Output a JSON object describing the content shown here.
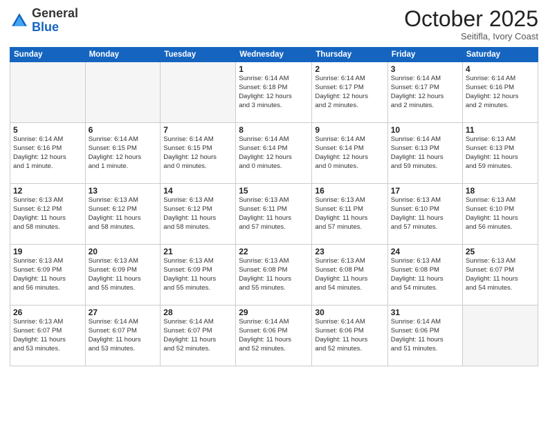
{
  "header": {
    "logo_general": "General",
    "logo_blue": "Blue",
    "month": "October 2025",
    "location": "Seitifla, Ivory Coast"
  },
  "days_of_week": [
    "Sunday",
    "Monday",
    "Tuesday",
    "Wednesday",
    "Thursday",
    "Friday",
    "Saturday"
  ],
  "weeks": [
    [
      {
        "day": "",
        "info": ""
      },
      {
        "day": "",
        "info": ""
      },
      {
        "day": "",
        "info": ""
      },
      {
        "day": "1",
        "info": "Sunrise: 6:14 AM\nSunset: 6:18 PM\nDaylight: 12 hours\nand 3 minutes."
      },
      {
        "day": "2",
        "info": "Sunrise: 6:14 AM\nSunset: 6:17 PM\nDaylight: 12 hours\nand 2 minutes."
      },
      {
        "day": "3",
        "info": "Sunrise: 6:14 AM\nSunset: 6:17 PM\nDaylight: 12 hours\nand 2 minutes."
      },
      {
        "day": "4",
        "info": "Sunrise: 6:14 AM\nSunset: 6:16 PM\nDaylight: 12 hours\nand 2 minutes."
      }
    ],
    [
      {
        "day": "5",
        "info": "Sunrise: 6:14 AM\nSunset: 6:16 PM\nDaylight: 12 hours\nand 1 minute."
      },
      {
        "day": "6",
        "info": "Sunrise: 6:14 AM\nSunset: 6:15 PM\nDaylight: 12 hours\nand 1 minute."
      },
      {
        "day": "7",
        "info": "Sunrise: 6:14 AM\nSunset: 6:15 PM\nDaylight: 12 hours\nand 0 minutes."
      },
      {
        "day": "8",
        "info": "Sunrise: 6:14 AM\nSunset: 6:14 PM\nDaylight: 12 hours\nand 0 minutes."
      },
      {
        "day": "9",
        "info": "Sunrise: 6:14 AM\nSunset: 6:14 PM\nDaylight: 12 hours\nand 0 minutes."
      },
      {
        "day": "10",
        "info": "Sunrise: 6:14 AM\nSunset: 6:13 PM\nDaylight: 11 hours\nand 59 minutes."
      },
      {
        "day": "11",
        "info": "Sunrise: 6:13 AM\nSunset: 6:13 PM\nDaylight: 11 hours\nand 59 minutes."
      }
    ],
    [
      {
        "day": "12",
        "info": "Sunrise: 6:13 AM\nSunset: 6:12 PM\nDaylight: 11 hours\nand 58 minutes."
      },
      {
        "day": "13",
        "info": "Sunrise: 6:13 AM\nSunset: 6:12 PM\nDaylight: 11 hours\nand 58 minutes."
      },
      {
        "day": "14",
        "info": "Sunrise: 6:13 AM\nSunset: 6:12 PM\nDaylight: 11 hours\nand 58 minutes."
      },
      {
        "day": "15",
        "info": "Sunrise: 6:13 AM\nSunset: 6:11 PM\nDaylight: 11 hours\nand 57 minutes."
      },
      {
        "day": "16",
        "info": "Sunrise: 6:13 AM\nSunset: 6:11 PM\nDaylight: 11 hours\nand 57 minutes."
      },
      {
        "day": "17",
        "info": "Sunrise: 6:13 AM\nSunset: 6:10 PM\nDaylight: 11 hours\nand 57 minutes."
      },
      {
        "day": "18",
        "info": "Sunrise: 6:13 AM\nSunset: 6:10 PM\nDaylight: 11 hours\nand 56 minutes."
      }
    ],
    [
      {
        "day": "19",
        "info": "Sunrise: 6:13 AM\nSunset: 6:09 PM\nDaylight: 11 hours\nand 56 minutes."
      },
      {
        "day": "20",
        "info": "Sunrise: 6:13 AM\nSunset: 6:09 PM\nDaylight: 11 hours\nand 55 minutes."
      },
      {
        "day": "21",
        "info": "Sunrise: 6:13 AM\nSunset: 6:09 PM\nDaylight: 11 hours\nand 55 minutes."
      },
      {
        "day": "22",
        "info": "Sunrise: 6:13 AM\nSunset: 6:08 PM\nDaylight: 11 hours\nand 55 minutes."
      },
      {
        "day": "23",
        "info": "Sunrise: 6:13 AM\nSunset: 6:08 PM\nDaylight: 11 hours\nand 54 minutes."
      },
      {
        "day": "24",
        "info": "Sunrise: 6:13 AM\nSunset: 6:08 PM\nDaylight: 11 hours\nand 54 minutes."
      },
      {
        "day": "25",
        "info": "Sunrise: 6:13 AM\nSunset: 6:07 PM\nDaylight: 11 hours\nand 54 minutes."
      }
    ],
    [
      {
        "day": "26",
        "info": "Sunrise: 6:13 AM\nSunset: 6:07 PM\nDaylight: 11 hours\nand 53 minutes."
      },
      {
        "day": "27",
        "info": "Sunrise: 6:14 AM\nSunset: 6:07 PM\nDaylight: 11 hours\nand 53 minutes."
      },
      {
        "day": "28",
        "info": "Sunrise: 6:14 AM\nSunset: 6:07 PM\nDaylight: 11 hours\nand 52 minutes."
      },
      {
        "day": "29",
        "info": "Sunrise: 6:14 AM\nSunset: 6:06 PM\nDaylight: 11 hours\nand 52 minutes."
      },
      {
        "day": "30",
        "info": "Sunrise: 6:14 AM\nSunset: 6:06 PM\nDaylight: 11 hours\nand 52 minutes."
      },
      {
        "day": "31",
        "info": "Sunrise: 6:14 AM\nSunset: 6:06 PM\nDaylight: 11 hours\nand 51 minutes."
      },
      {
        "day": "",
        "info": ""
      }
    ]
  ]
}
